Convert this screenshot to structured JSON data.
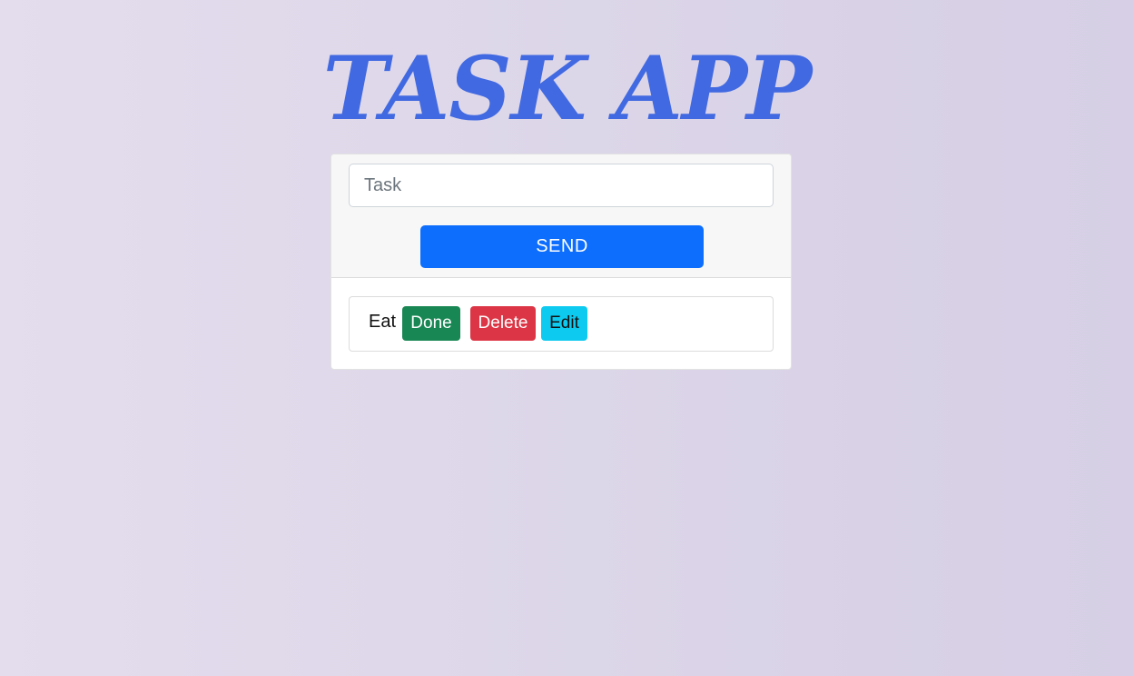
{
  "app": {
    "title": "TASK APP"
  },
  "form": {
    "task_placeholder": "Task",
    "task_value": "",
    "send_label": "SEND"
  },
  "tasks": [
    {
      "text": "Eat",
      "done_label": "Done",
      "delete_label": "Delete",
      "edit_label": "Edit"
    }
  ],
  "colors": {
    "title": "#4169e1",
    "send": "#0d6efd",
    "done": "#198754",
    "delete": "#dc3545",
    "edit": "#0dcaf0"
  }
}
